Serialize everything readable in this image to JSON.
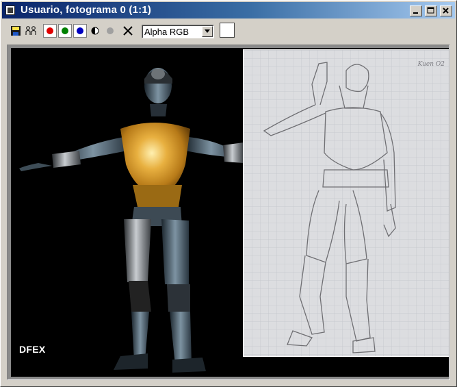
{
  "window": {
    "title": "Usuario, fotograma 0 (1:1)",
    "controls": [
      {
        "name": "minimize-button",
        "icon": "minimize-icon"
      },
      {
        "name": "maximize-button",
        "icon": "maximize-icon"
      },
      {
        "name": "close-button",
        "icon": "close-icon"
      }
    ]
  },
  "toolbar": {
    "save_icon": "floppy-disk-icon",
    "clone_icon": "clone-window-icon",
    "channels": [
      {
        "name": "red-channel-button",
        "color": "#e00000"
      },
      {
        "name": "green-channel-button",
        "color": "#008000"
      },
      {
        "name": "blue-channel-button",
        "color": "#0000c0"
      }
    ],
    "mono_icon": "monochrome-icon",
    "alpha_icon": "alpha-dot-icon",
    "clear_icon": "clear-x-icon",
    "channel_select": {
      "value": "Alpha RGB"
    },
    "color_swatch": "#ffffff"
  },
  "viewport": {
    "watermark": "DFEX",
    "sketch_corner_text": "Kuen O2"
  }
}
